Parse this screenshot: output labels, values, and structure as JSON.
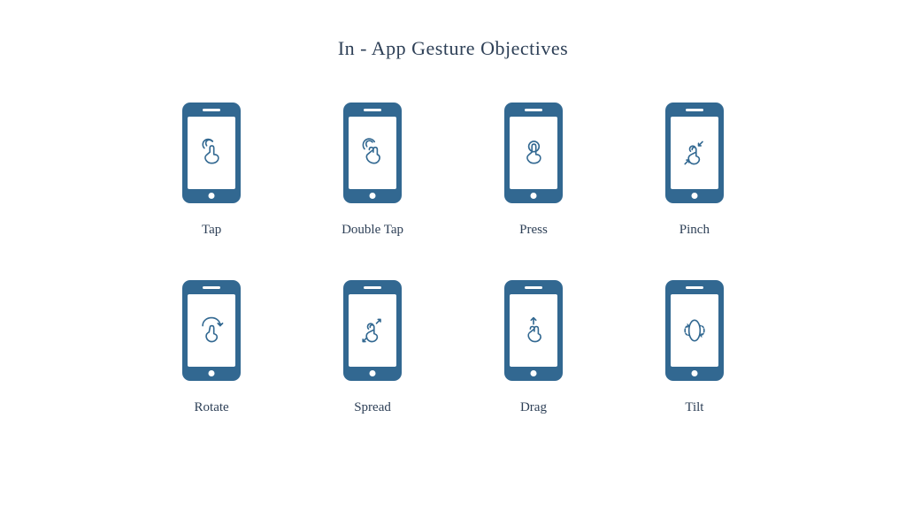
{
  "title": "In - App Gesture Objectives",
  "gestures": [
    {
      "label": "Tap",
      "icon": "tap-icon"
    },
    {
      "label": "Double Tap",
      "icon": "double-tap-icon"
    },
    {
      "label": "Press",
      "icon": "press-icon"
    },
    {
      "label": "Pinch",
      "icon": "pinch-icon"
    },
    {
      "label": "Rotate",
      "icon": "rotate-icon"
    },
    {
      "label": "Spread",
      "icon": "spread-icon"
    },
    {
      "label": "Drag",
      "icon": "drag-icon"
    },
    {
      "label": "Tilt",
      "icon": "tilt-icon"
    }
  ],
  "colors": {
    "primary": "#326891",
    "text": "#2e4057"
  }
}
